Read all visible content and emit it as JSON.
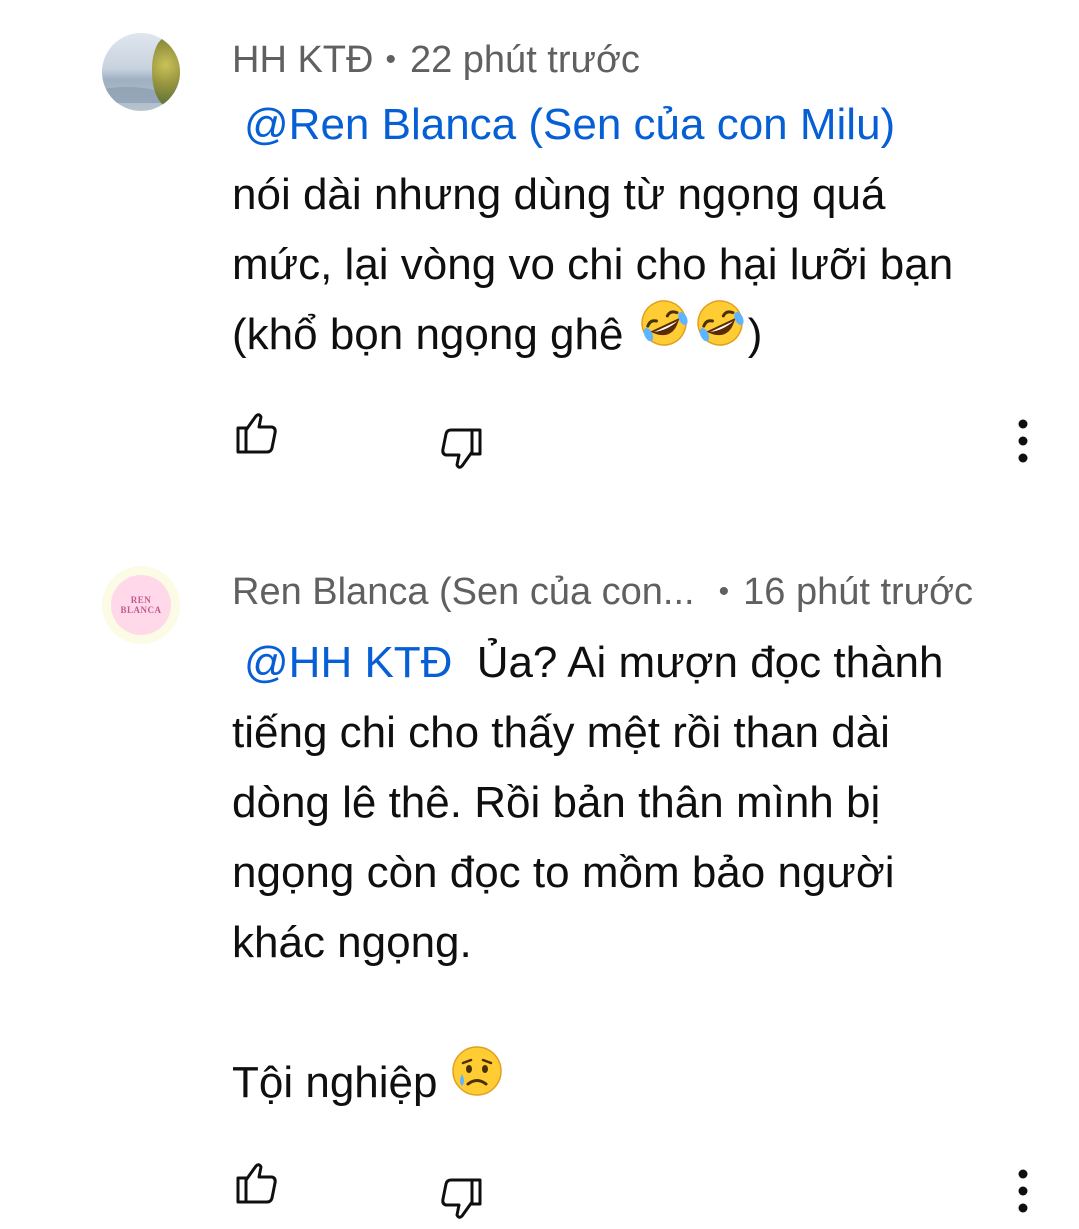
{
  "comments": [
    {
      "author": "HH KTĐ",
      "separator": "•",
      "time": "22 phút trước",
      "mention": "@Ren Blanca (Sen của con Milu)",
      "lines": [
        "nói dài nhưng dùng từ ngọng quá",
        "mức, lại vòng vo chi cho hại lưỡi bạn",
        "(khổ bọn ngọng ghê"
      ],
      "line3_suffix": ")",
      "emoji": "rolling-on-floor-laughing-emoji x2"
    },
    {
      "author": "Ren Blanca (Sen của con...",
      "separator": "•",
      "time": "16 phút trước",
      "avatar_logo": [
        "REN",
        "BLANCA"
      ],
      "mention": "@HH KTĐ",
      "first_line_text": "Ủa? Ai mượn đọc thành",
      "lines": [
        "tiếng chi cho thấy mệt rồi than dài",
        "dòng lê thê. Rồi bản thân mình bị",
        "ngọng còn đọc to mồm bảo người",
        "khác ngọng."
      ],
      "last_line": "Tội nghiệp",
      "emoji": "sad-but-relieved-emoji"
    }
  ],
  "icons": {
    "like": "thumbs-up-icon",
    "dislike": "thumbs-down-icon",
    "more": "more-vertical-icon"
  },
  "colors": {
    "mention": "#065fd4",
    "meta": "#606060",
    "text": "#0f0f0f"
  }
}
